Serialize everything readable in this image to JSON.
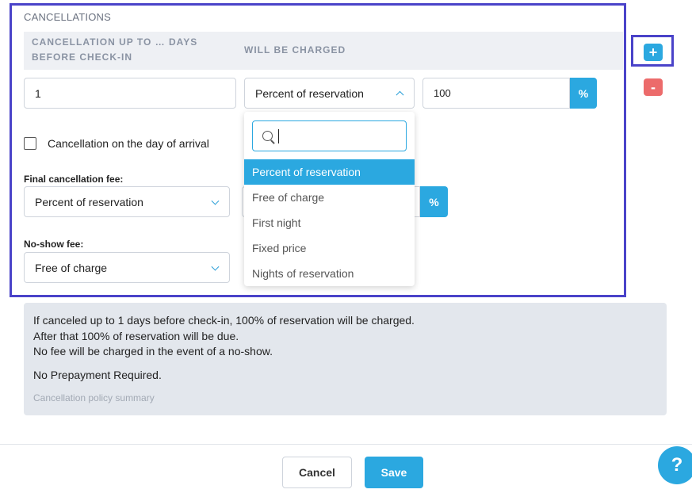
{
  "section": {
    "title": "CANCELLATIONS"
  },
  "columns": {
    "days_header": "CANCELLATION UP TO … DAYS BEFORE CHECK-IN",
    "charged_header": "WILL BE CHARGED"
  },
  "rule_row": {
    "days_value": "1",
    "charge_type": "Percent of reservation",
    "amount_value": "100",
    "unit_label": "%"
  },
  "actions": {
    "add_label": "+",
    "remove_label": "-"
  },
  "dropdown": {
    "search_value": "",
    "options": [
      {
        "label": "Percent of reservation",
        "selected": true
      },
      {
        "label": "Free of charge",
        "selected": false
      },
      {
        "label": "First night",
        "selected": false
      },
      {
        "label": "Fixed price",
        "selected": false
      },
      {
        "label": "Nights of reservation",
        "selected": false
      }
    ]
  },
  "day_of_arrival": {
    "label": "Cancellation on the day of arrival",
    "checked": false
  },
  "final_fee": {
    "label": "Final cancellation fee:",
    "value": "Percent of reservation",
    "unit_label": "%"
  },
  "no_show": {
    "label": "No-show fee:",
    "value": "Free of charge"
  },
  "summary": {
    "line1": "If canceled up to 1 days before check-in, 100% of reservation will be charged.",
    "line2": "After that 100% of reservation will be due.",
    "line3": "No fee will be charged in the event of a no-show.",
    "line4": "No Prepayment Required.",
    "footer": "Cancellation policy summary"
  },
  "footer": {
    "cancel_label": "Cancel",
    "save_label": "Save",
    "help_label": "?"
  },
  "colors": {
    "accent": "#2ba8e0",
    "danger": "#ec6b6b",
    "highlight": "#4a43c9"
  }
}
